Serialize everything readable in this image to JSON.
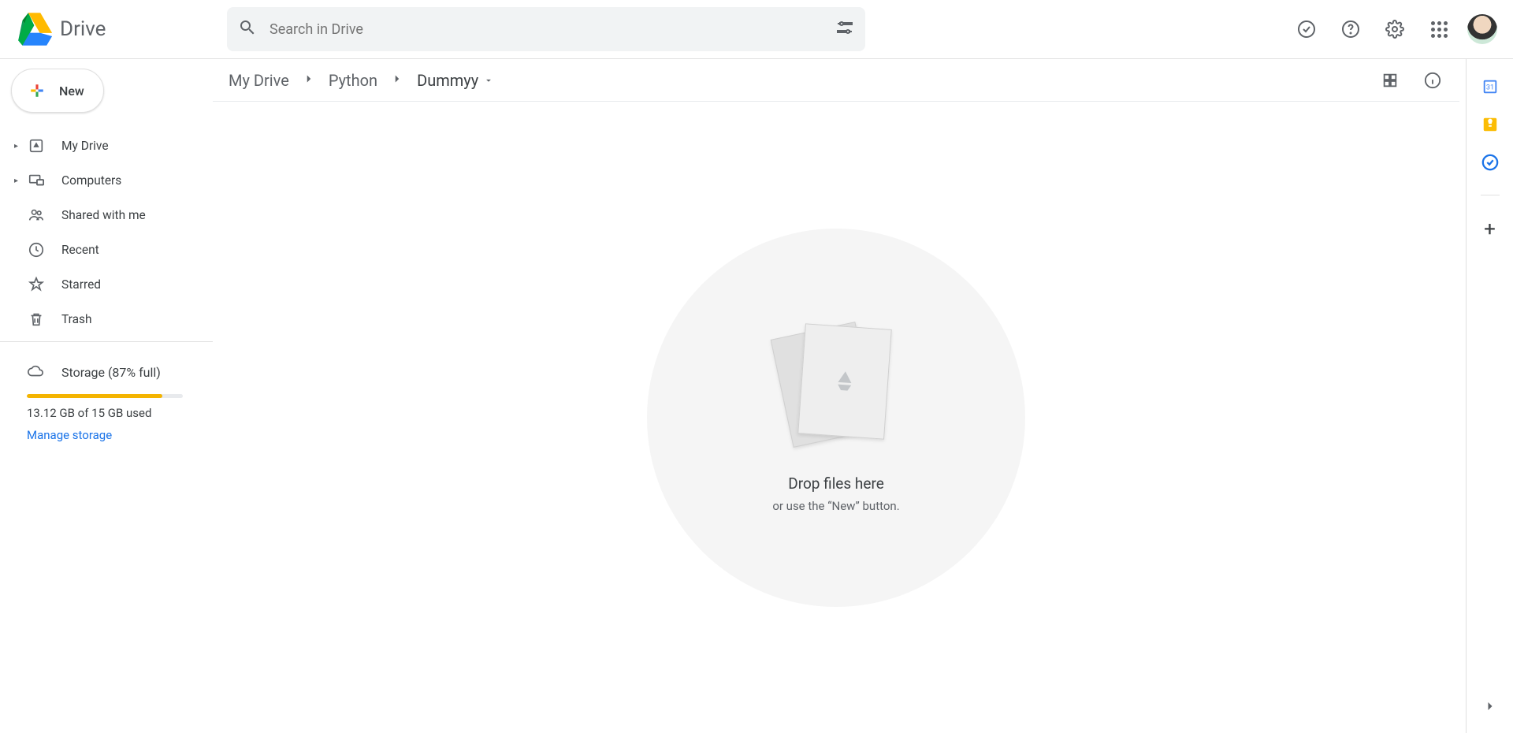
{
  "header": {
    "product_name": "Drive",
    "search_placeholder": "Search in Drive"
  },
  "sidebar": {
    "new_button": "New",
    "items": [
      {
        "label": "My Drive",
        "has_children": true,
        "icon": "drive"
      },
      {
        "label": "Computers",
        "has_children": true,
        "icon": "computer"
      },
      {
        "label": "Shared with me",
        "has_children": false,
        "icon": "people"
      },
      {
        "label": "Recent",
        "has_children": false,
        "icon": "clock"
      },
      {
        "label": "Starred",
        "has_children": false,
        "icon": "star"
      },
      {
        "label": "Trash",
        "has_children": false,
        "icon": "trash"
      }
    ],
    "storage": {
      "label": "Storage (87% full)",
      "percent": 87,
      "usage_text": "13.12 GB of 15 GB used",
      "manage_link": "Manage storage"
    }
  },
  "breadcrumb": {
    "segments": [
      "My Drive",
      "Python",
      "Dummyy"
    ]
  },
  "empty_state": {
    "title": "Drop files here",
    "subtitle": "or use the “New” button."
  },
  "right_panel": {
    "calendar_day": "31"
  }
}
